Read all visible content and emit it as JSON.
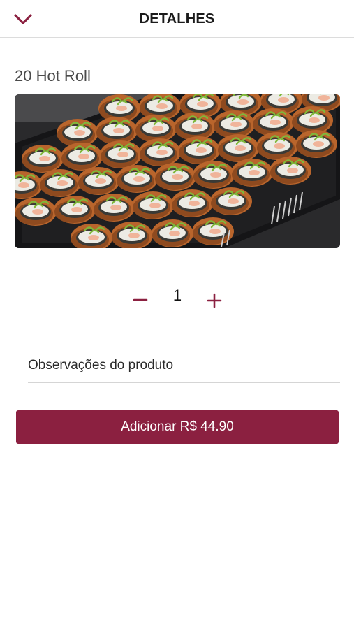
{
  "header": {
    "title": "DETALHES",
    "back_icon": "chevron-down-icon",
    "accent_color": "#8b2040"
  },
  "product": {
    "name": "20 Hot Roll",
    "image": "hot-roll-tray-photo"
  },
  "quantity": {
    "value": "1",
    "decrement_icon": "minus-icon",
    "increment_icon": "plus-icon"
  },
  "notes": {
    "placeholder": "Observações do produto",
    "value": ""
  },
  "add_button": {
    "label": "Adicionar R$ 44.90",
    "color": "#8b2040"
  }
}
